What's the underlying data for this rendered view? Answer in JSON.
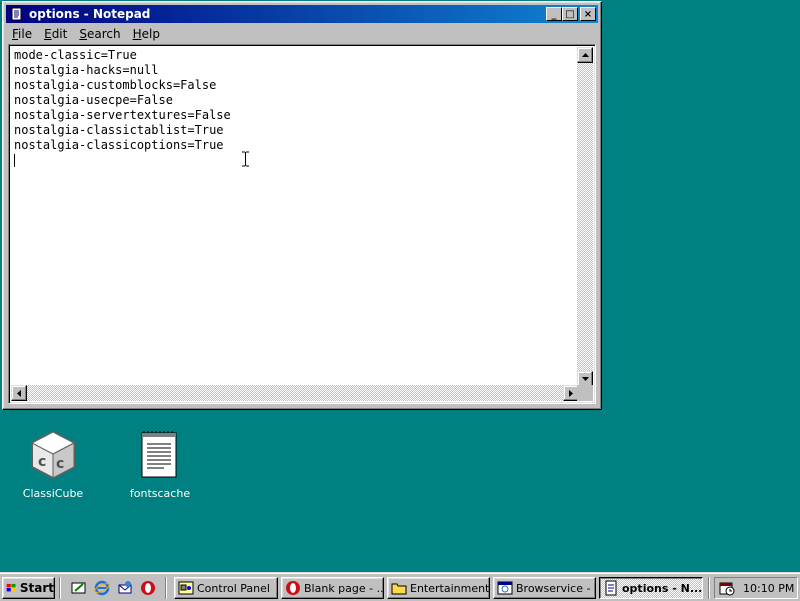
{
  "window": {
    "title": "options - Notepad",
    "minimize_glyph": "_",
    "maximize_glyph": "□",
    "close_glyph": "×",
    "menu": [
      {
        "label": "File",
        "accel": "F",
        "rest": "ile"
      },
      {
        "label": "Edit",
        "accel": "E",
        "rest": "dit"
      },
      {
        "label": "Search",
        "accel": "S",
        "rest": "earch"
      },
      {
        "label": "Help",
        "accel": "H",
        "rest": "elp"
      }
    ],
    "lines": [
      "mode-classic=True",
      "nostalgia-hacks=null",
      "nostalgia-customblocks=False",
      "nostalgia-usecpe=False",
      "nostalgia-servertextures=False",
      "nostalgia-classictablist=True",
      "nostalgia-classicoptions=True"
    ]
  },
  "desktop": {
    "icons": [
      {
        "label": "ClassiCube",
        "icon": "classicube-icon"
      },
      {
        "label": "fontscache",
        "icon": "text-document-icon"
      }
    ]
  },
  "taskbar": {
    "start_label": "Start",
    "quick_launch": [
      "show-desktop-icon",
      "internet-explorer-icon",
      "outlook-express-icon",
      "opera-icon"
    ],
    "tasks": [
      {
        "label": "Control Panel",
        "icon": "control-panel-icon",
        "active": false
      },
      {
        "label": "Blank page - ...",
        "icon": "opera-icon",
        "active": false
      },
      {
        "label": "Entertainment",
        "icon": "folder-icon",
        "active": false
      },
      {
        "label": "Browservice - ...",
        "icon": "browser-window-icon",
        "active": false
      },
      {
        "label": "options - N...",
        "icon": "notepad-icon",
        "active": true
      }
    ],
    "clock": "10:10 PM"
  },
  "colors": {
    "desktop": "#008080",
    "title_active_start": "#000080",
    "title_active_end": "#1084d0",
    "face": "#c0c0c0"
  }
}
